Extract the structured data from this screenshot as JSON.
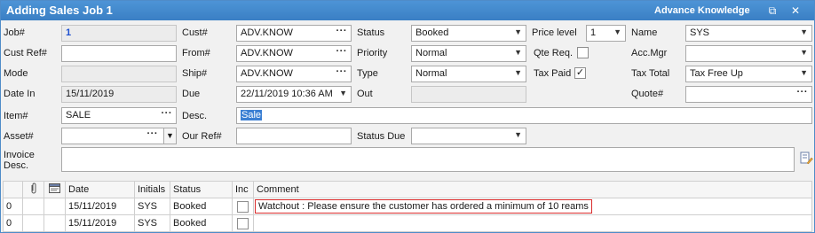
{
  "window": {
    "title": "Adding Sales Job 1",
    "company": "Advance Knowledge",
    "restore_glyph": "⧉",
    "close_glyph": "✕"
  },
  "labels": {
    "job": "Job#",
    "cust_ref": "Cust Ref#",
    "mode": "Mode",
    "date_in": "Date In",
    "item": "Item#",
    "asset": "Asset#",
    "invoice_desc": "Invoice Desc.",
    "cust": "Cust#",
    "from": "From#",
    "ship": "Ship#",
    "due": "Due",
    "desc": "Desc.",
    "our_ref": "Our Ref#",
    "status": "Status",
    "priority": "Priority",
    "type": "Type",
    "out": "Out",
    "status_due": "Status Due",
    "price_level": "Price level",
    "qte_req": "Qte Req.",
    "tax_paid": "Tax Paid",
    "name": "Name",
    "acc_mgr": "Acc.Mgr",
    "tax_total": "Tax Total",
    "quote": "Quote#"
  },
  "fields": {
    "job": "1",
    "cust_ref": "",
    "mode": "",
    "date_in": "15/11/2019",
    "item": "SALE",
    "asset": "",
    "invoice_desc": "",
    "cust": "ADV.KNOW",
    "from": "ADV.KNOW",
    "ship": "ADV.KNOW",
    "due": "22/11/2019 10:36 AM",
    "desc": "Sale",
    "our_ref": "",
    "status": "Booked",
    "priority": "Normal",
    "type": "Normal",
    "out": "",
    "status_due": "",
    "price_level": "1",
    "qte_req": false,
    "tax_paid": true,
    "name": "SYS",
    "acc_mgr": "",
    "tax_total": "Tax Free Up",
    "quote": ""
  },
  "icons": {
    "dots": "···",
    "dropdown": "▼",
    "check": "✓",
    "paperclip": "paperclip-icon",
    "note": "note-icon",
    "edit_desc": "edit-document-icon"
  },
  "grid": {
    "columns": [
      "",
      "",
      "",
      "Date",
      "Initials",
      "Status",
      "Inc",
      "Comment"
    ],
    "rows": [
      {
        "num": "0",
        "date": "15/11/2019",
        "initials": "SYS",
        "status": "Booked",
        "inc": false,
        "comment": "Watchout : Please ensure the customer has ordered a minimum of 10 reams"
      },
      {
        "num": "0",
        "date": "15/11/2019",
        "initials": "SYS",
        "status": "Booked",
        "inc": false,
        "comment": ""
      }
    ]
  },
  "colors": {
    "title_bar": "#3a7fc4",
    "job_value": "#1d4fd0",
    "comment_highlight_border": "#d92b2b",
    "selection": "#3b7fd3"
  }
}
